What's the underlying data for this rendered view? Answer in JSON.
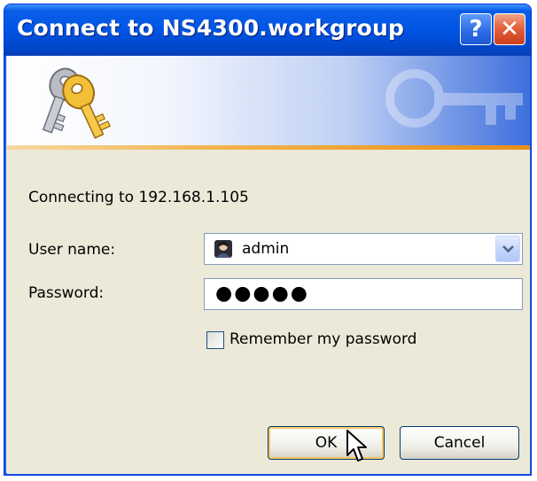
{
  "window": {
    "title": "Connect to NS4300.workgroup",
    "help_label": "?",
    "close_label": "✕"
  },
  "banner": {
    "icon": "keys-icon"
  },
  "form": {
    "connecting_text": "Connecting to 192.168.1.105",
    "username_label": "User name:",
    "username_value": "admin",
    "password_label": "Password:",
    "password_mask": "●●●●●",
    "remember_label": "Remember my password",
    "remember_checked": false
  },
  "buttons": {
    "ok_label": "OK",
    "cancel_label": "Cancel"
  },
  "colors": {
    "titlebar": "#0055e5",
    "dialog_background": "#ece9d8",
    "banner_stripe": "#f3b44f",
    "default_button_highlight": "#fbc761"
  }
}
